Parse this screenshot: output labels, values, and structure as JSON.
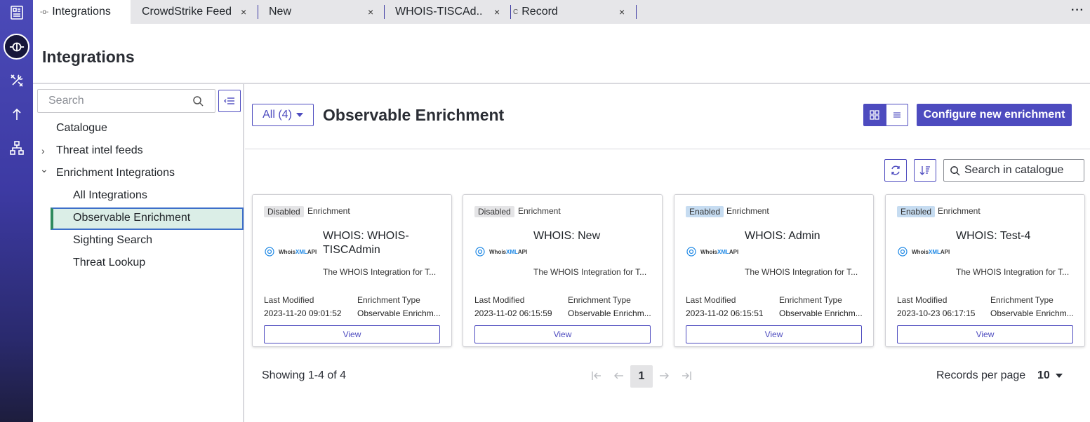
{
  "tabs": [
    {
      "label": "Integrations",
      "icon": "integrations-icon",
      "active": true
    },
    {
      "label": "CrowdStrike Feed",
      "close": "×"
    },
    {
      "label": "New",
      "close": "×"
    },
    {
      "label": "WHOIS-TISCAd...",
      "close": "×"
    },
    {
      "label": "Record",
      "prefix": "C",
      "close": "×"
    }
  ],
  "overflow_menu": "···",
  "page": {
    "title": "Integrations"
  },
  "nav": {
    "search_placeholder": "Search",
    "items": [
      {
        "label": "Catalogue"
      },
      {
        "label": "Threat intel feeds",
        "chevron": "›"
      },
      {
        "label": "Enrichment Integrations",
        "chevron": "⌄"
      },
      {
        "label": "All Integrations"
      },
      {
        "label": "Observable Enrichment",
        "selected": true
      },
      {
        "label": "Sighting Search"
      },
      {
        "label": "Threat Lookup"
      }
    ]
  },
  "main": {
    "filter_label": "All (4)",
    "section_title": "Observable Enrichment",
    "configure_label": "Configure new enrichment",
    "catalog_search_placeholder": "Search in catalogue"
  },
  "cards": [
    {
      "status": "Disabled",
      "type": "Enrichment",
      "name": "WHOIS: WHOIS-TISCAdmin",
      "description": "The WHOIS Integration for T...",
      "last_modified_label": "Last Modified",
      "last_modified": "2023-11-20 09:01:52",
      "enrichment_type_label": "Enrichment Type",
      "enrichment_type": "Observable Enrichm...",
      "view_label": "View"
    },
    {
      "status": "Disabled",
      "type": "Enrichment",
      "name": "WHOIS: New",
      "description": "The WHOIS Integration for T...",
      "last_modified_label": "Last Modified",
      "last_modified": "2023-11-02 06:15:59",
      "enrichment_type_label": "Enrichment Type",
      "enrichment_type": "Observable Enrichm...",
      "view_label": "View"
    },
    {
      "status": "Enabled",
      "type": "Enrichment",
      "name": "WHOIS: Admin",
      "description": "The WHOIS Integration for T...",
      "last_modified_label": "Last Modified",
      "last_modified": "2023-11-02 06:15:51",
      "enrichment_type_label": "Enrichment Type",
      "enrichment_type": "Observable Enrichm...",
      "view_label": "View"
    },
    {
      "status": "Enabled",
      "type": "Enrichment",
      "name": "WHOIS: Test-4",
      "description": "The WHOIS Integration for T...",
      "last_modified_label": "Last Modified",
      "last_modified": "2023-10-23 06:17:15",
      "enrichment_type_label": "Enrichment Type",
      "enrichment_type": "Observable Enrichm...",
      "view_label": "View"
    }
  ],
  "logo": {
    "whois": "Whois",
    "xml": "XML",
    "api": "API"
  },
  "pagination": {
    "showing": "Showing 1-4 of 4",
    "current_page": "1",
    "records_per_page_label": "Records per page",
    "records_per_page": "10"
  },
  "colors": {
    "accent": "#4d4bbf",
    "selected_bg": "#dbeee7",
    "enabled_badge": "#c6dcf1",
    "disabled_badge": "#e4e4e6"
  }
}
